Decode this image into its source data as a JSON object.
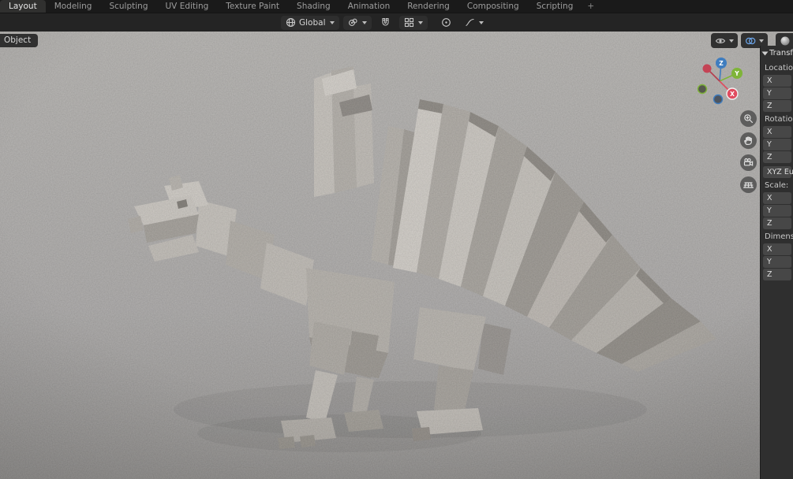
{
  "topbar": {
    "active_tab": "Layout",
    "tabs": [
      "Layout",
      "Modeling",
      "Sculpting",
      "UV Editing",
      "Texture Paint",
      "Shading",
      "Animation",
      "Rendering",
      "Compositing",
      "Scripting"
    ],
    "add_label": "+"
  },
  "toolbar": {
    "orientation_label": "Global",
    "icons": [
      "globe-icon",
      "chevron-down-icon",
      "pivot-point-icon",
      "snap-magnet-icon",
      "snap-settings-icon",
      "proportional-editing-icon",
      "proportional-falloff-icon"
    ]
  },
  "viewport": {
    "mode_label": "Object",
    "gizmo": {
      "x": "X",
      "y": "Y",
      "z": "Z"
    },
    "nav_icons": [
      "zoom-icon",
      "hand-icon",
      "camera-icon",
      "grid-icon"
    ],
    "header_icons": [
      "visibility-icon",
      "overlays-icon",
      "viewport-shading-icon"
    ],
    "colors": {
      "axis_x": "#e04c5f",
      "axis_y": "#7fb439",
      "axis_z": "#3f7dbf",
      "overlay_active": "#6ba4e8"
    }
  },
  "sidebar": {
    "header": "Transform",
    "location_label": "Location:",
    "rotation_label": "Rotation:",
    "rotation_mode": "XYZ Euler",
    "scale_label": "Scale:",
    "dimensions_label": "Dimensions:",
    "axis": {
      "x": "X",
      "y": "Y",
      "z": "Z"
    }
  }
}
